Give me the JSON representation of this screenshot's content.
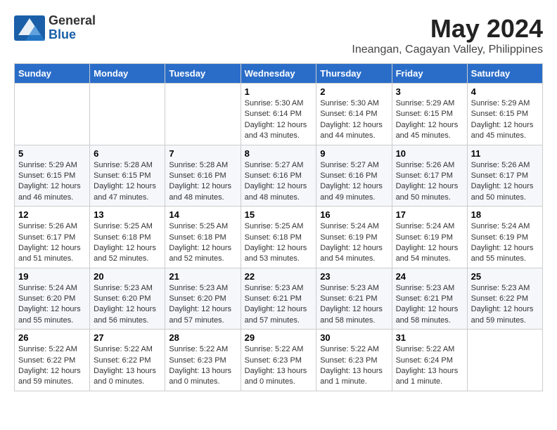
{
  "logo": {
    "general": "General",
    "blue": "Blue"
  },
  "title": "May 2024",
  "location": "Ineangan, Cagayan Valley, Philippines",
  "headers": [
    "Sunday",
    "Monday",
    "Tuesday",
    "Wednesday",
    "Thursday",
    "Friday",
    "Saturday"
  ],
  "weeks": [
    [
      {
        "day": "",
        "info": ""
      },
      {
        "day": "",
        "info": ""
      },
      {
        "day": "",
        "info": ""
      },
      {
        "day": "1",
        "info": "Sunrise: 5:30 AM\nSunset: 6:14 PM\nDaylight: 12 hours\nand 43 minutes."
      },
      {
        "day": "2",
        "info": "Sunrise: 5:30 AM\nSunset: 6:14 PM\nDaylight: 12 hours\nand 44 minutes."
      },
      {
        "day": "3",
        "info": "Sunrise: 5:29 AM\nSunset: 6:15 PM\nDaylight: 12 hours\nand 45 minutes."
      },
      {
        "day": "4",
        "info": "Sunrise: 5:29 AM\nSunset: 6:15 PM\nDaylight: 12 hours\nand 45 minutes."
      }
    ],
    [
      {
        "day": "5",
        "info": "Sunrise: 5:29 AM\nSunset: 6:15 PM\nDaylight: 12 hours\nand 46 minutes."
      },
      {
        "day": "6",
        "info": "Sunrise: 5:28 AM\nSunset: 6:15 PM\nDaylight: 12 hours\nand 47 minutes."
      },
      {
        "day": "7",
        "info": "Sunrise: 5:28 AM\nSunset: 6:16 PM\nDaylight: 12 hours\nand 48 minutes."
      },
      {
        "day": "8",
        "info": "Sunrise: 5:27 AM\nSunset: 6:16 PM\nDaylight: 12 hours\nand 48 minutes."
      },
      {
        "day": "9",
        "info": "Sunrise: 5:27 AM\nSunset: 6:16 PM\nDaylight: 12 hours\nand 49 minutes."
      },
      {
        "day": "10",
        "info": "Sunrise: 5:26 AM\nSunset: 6:17 PM\nDaylight: 12 hours\nand 50 minutes."
      },
      {
        "day": "11",
        "info": "Sunrise: 5:26 AM\nSunset: 6:17 PM\nDaylight: 12 hours\nand 50 minutes."
      }
    ],
    [
      {
        "day": "12",
        "info": "Sunrise: 5:26 AM\nSunset: 6:17 PM\nDaylight: 12 hours\nand 51 minutes."
      },
      {
        "day": "13",
        "info": "Sunrise: 5:25 AM\nSunset: 6:18 PM\nDaylight: 12 hours\nand 52 minutes."
      },
      {
        "day": "14",
        "info": "Sunrise: 5:25 AM\nSunset: 6:18 PM\nDaylight: 12 hours\nand 52 minutes."
      },
      {
        "day": "15",
        "info": "Sunrise: 5:25 AM\nSunset: 6:18 PM\nDaylight: 12 hours\nand 53 minutes."
      },
      {
        "day": "16",
        "info": "Sunrise: 5:24 AM\nSunset: 6:19 PM\nDaylight: 12 hours\nand 54 minutes."
      },
      {
        "day": "17",
        "info": "Sunrise: 5:24 AM\nSunset: 6:19 PM\nDaylight: 12 hours\nand 54 minutes."
      },
      {
        "day": "18",
        "info": "Sunrise: 5:24 AM\nSunset: 6:19 PM\nDaylight: 12 hours\nand 55 minutes."
      }
    ],
    [
      {
        "day": "19",
        "info": "Sunrise: 5:24 AM\nSunset: 6:20 PM\nDaylight: 12 hours\nand 55 minutes."
      },
      {
        "day": "20",
        "info": "Sunrise: 5:23 AM\nSunset: 6:20 PM\nDaylight: 12 hours\nand 56 minutes."
      },
      {
        "day": "21",
        "info": "Sunrise: 5:23 AM\nSunset: 6:20 PM\nDaylight: 12 hours\nand 57 minutes."
      },
      {
        "day": "22",
        "info": "Sunrise: 5:23 AM\nSunset: 6:21 PM\nDaylight: 12 hours\nand 57 minutes."
      },
      {
        "day": "23",
        "info": "Sunrise: 5:23 AM\nSunset: 6:21 PM\nDaylight: 12 hours\nand 58 minutes."
      },
      {
        "day": "24",
        "info": "Sunrise: 5:23 AM\nSunset: 6:21 PM\nDaylight: 12 hours\nand 58 minutes."
      },
      {
        "day": "25",
        "info": "Sunrise: 5:23 AM\nSunset: 6:22 PM\nDaylight: 12 hours\nand 59 minutes."
      }
    ],
    [
      {
        "day": "26",
        "info": "Sunrise: 5:22 AM\nSunset: 6:22 PM\nDaylight: 12 hours\nand 59 minutes."
      },
      {
        "day": "27",
        "info": "Sunrise: 5:22 AM\nSunset: 6:22 PM\nDaylight: 13 hours\nand 0 minutes."
      },
      {
        "day": "28",
        "info": "Sunrise: 5:22 AM\nSunset: 6:23 PM\nDaylight: 13 hours\nand 0 minutes."
      },
      {
        "day": "29",
        "info": "Sunrise: 5:22 AM\nSunset: 6:23 PM\nDaylight: 13 hours\nand 0 minutes."
      },
      {
        "day": "30",
        "info": "Sunrise: 5:22 AM\nSunset: 6:23 PM\nDaylight: 13 hours\nand 1 minute."
      },
      {
        "day": "31",
        "info": "Sunrise: 5:22 AM\nSunset: 6:24 PM\nDaylight: 13 hours\nand 1 minute."
      },
      {
        "day": "",
        "info": ""
      }
    ]
  ]
}
